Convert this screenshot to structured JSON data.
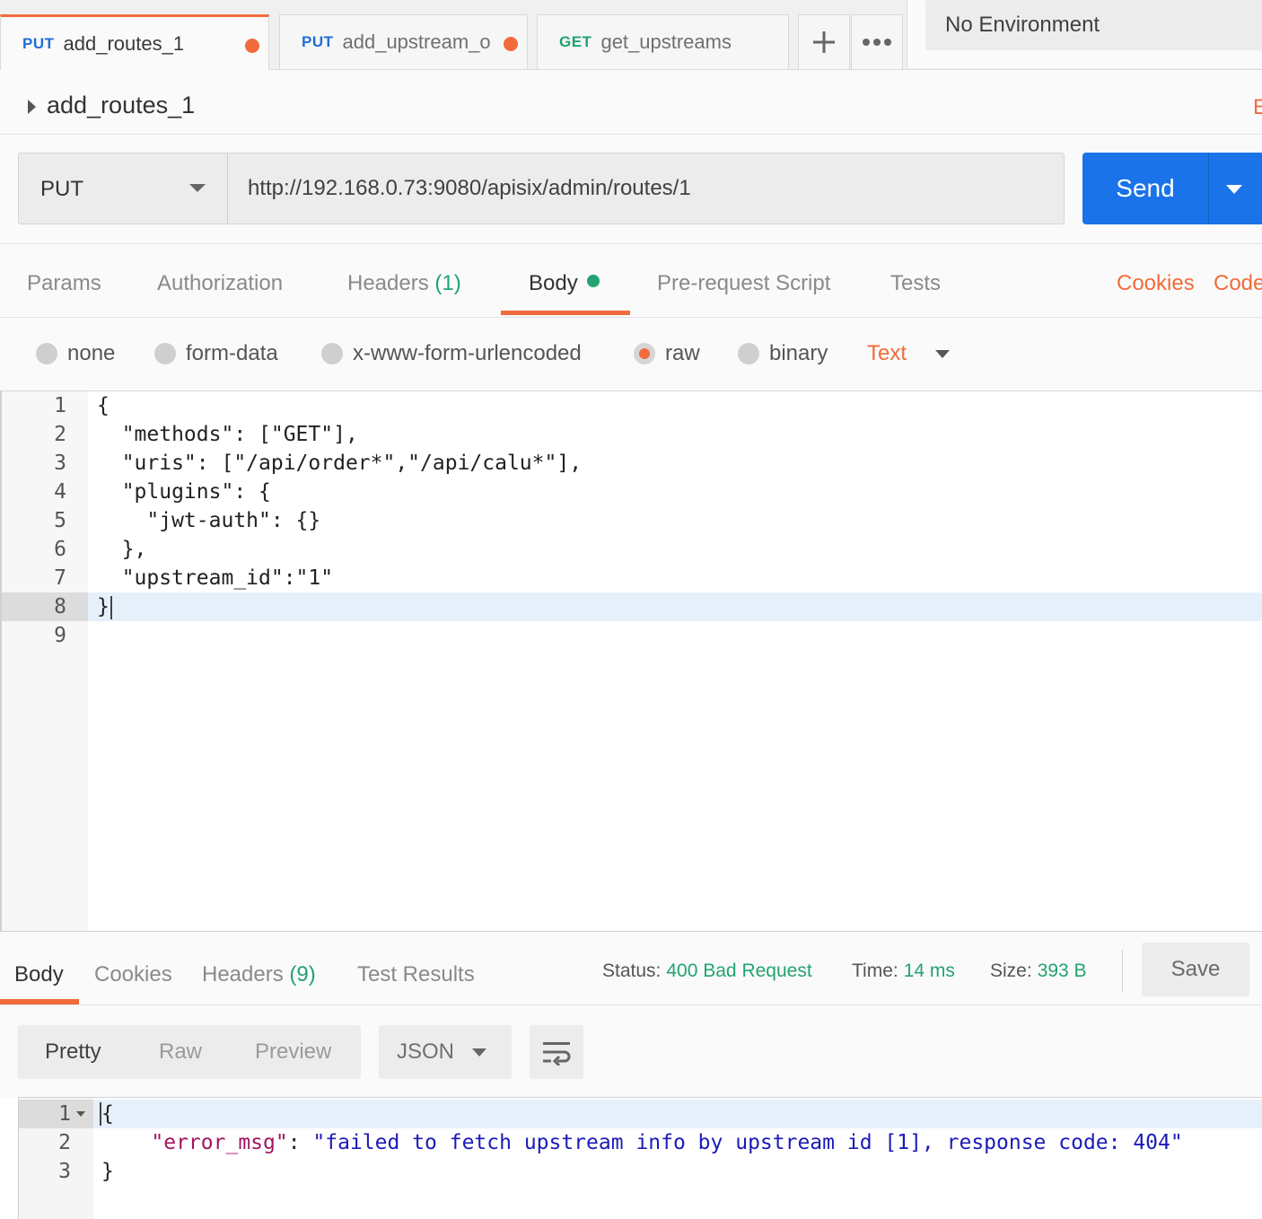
{
  "tabs": [
    {
      "method": "PUT",
      "name": "add_routes_1",
      "unsaved": true,
      "active": true
    },
    {
      "method": "PUT",
      "name": "add_upstream_o",
      "unsaved": true,
      "active": false
    },
    {
      "method": "GET",
      "name": "get_upstreams",
      "unsaved": false,
      "active": false
    }
  ],
  "tab_actions": {
    "new_tab_icon": "plus-icon",
    "more_icon": "ellipsis-icon"
  },
  "environment": {
    "selected": "No Environment"
  },
  "request": {
    "title": "add_routes_1",
    "edge_label": "E",
    "method": "PUT",
    "url": "http://192.168.0.73:9080/apisix/admin/routes/1",
    "send_label": "Send"
  },
  "request_tabs": {
    "params": "Params",
    "authorization": "Authorization",
    "headers": "Headers",
    "headers_count": "(1)",
    "body": "Body",
    "pre_request": "Pre-request Script",
    "tests": "Tests",
    "cookies": "Cookies",
    "code": "Code"
  },
  "body_modes": {
    "none": "none",
    "form_data": "form-data",
    "urlencoded": "x-www-form-urlencoded",
    "raw": "raw",
    "binary": "binary",
    "selected": "raw",
    "raw_type": "Text"
  },
  "editor": {
    "line_numbers": [
      "1",
      "2",
      "3",
      "4",
      "5",
      "6",
      "7",
      "8",
      "9"
    ],
    "lines": [
      "{",
      "  \"methods\": [\"GET\"],",
      "  \"uris\": [\"/api/order*\",\"/api/calu*\"],",
      "  \"plugins\": {",
      "    \"jwt-auth\": {}",
      "  },",
      "  \"upstream_id\":\"1\"",
      "}",
      ""
    ],
    "active_line": 8
  },
  "response_tabs": {
    "body": "Body",
    "cookies": "Cookies",
    "headers": "Headers",
    "headers_count": "(9)",
    "test_results": "Test Results"
  },
  "response_meta": {
    "status_label": "Status:",
    "status_value": "400 Bad Request",
    "time_label": "Time:",
    "time_value": "14 ms",
    "size_label": "Size:",
    "size_value": "393 B",
    "save_label": "Save"
  },
  "response_view": {
    "pretty": "Pretty",
    "raw": "Raw",
    "preview": "Preview",
    "format": "JSON",
    "wrap_icon": "wrap-lines-icon"
  },
  "response_body": {
    "line_numbers": [
      "1",
      "2",
      "3"
    ],
    "open_brace": "{",
    "key": "\"error_msg\"",
    "colon": ": ",
    "value": "\"failed to fetch upstream info by upstream id [1], response code: 404\"",
    "close_brace": "}"
  },
  "colors": {
    "accent": "#f26b3a",
    "send": "#1a73e8",
    "method_put": "#1f6ed4",
    "method_get": "#22a371",
    "success_text": "#22a371"
  }
}
